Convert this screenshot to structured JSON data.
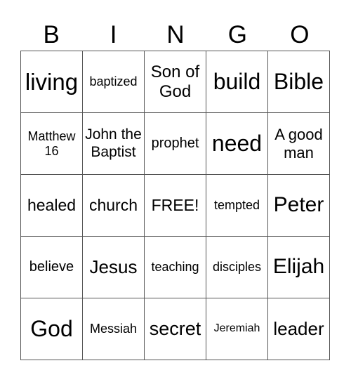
{
  "header": [
    "B",
    "I",
    "N",
    "G",
    "O"
  ],
  "rows": [
    [
      {
        "text": "living",
        "size": 33
      },
      {
        "text": "baptized",
        "size": 18
      },
      {
        "text": "Son of God",
        "size": 24
      },
      {
        "text": "build",
        "size": 32
      },
      {
        "text": "Bible",
        "size": 32
      }
    ],
    [
      {
        "text": "Matthew 16",
        "size": 18
      },
      {
        "text": "John the Baptist",
        "size": 21
      },
      {
        "text": "prophet",
        "size": 20
      },
      {
        "text": "need",
        "size": 32
      },
      {
        "text": "A good man",
        "size": 22
      }
    ],
    [
      {
        "text": "healed",
        "size": 23
      },
      {
        "text": "church",
        "size": 23
      },
      {
        "text": "FREE!",
        "size": 23
      },
      {
        "text": "tempted",
        "size": 18
      },
      {
        "text": "Peter",
        "size": 30
      }
    ],
    [
      {
        "text": "believe",
        "size": 20
      },
      {
        "text": "Jesus",
        "size": 26
      },
      {
        "text": "teaching",
        "size": 18
      },
      {
        "text": "disciples",
        "size": 18
      },
      {
        "text": "Elijah",
        "size": 30
      }
    ],
    [
      {
        "text": "God",
        "size": 32
      },
      {
        "text": "Messiah",
        "size": 18
      },
      {
        "text": "secret",
        "size": 27
      },
      {
        "text": "Jeremiah",
        "size": 16
      },
      {
        "text": "leader",
        "size": 26
      }
    ]
  ]
}
